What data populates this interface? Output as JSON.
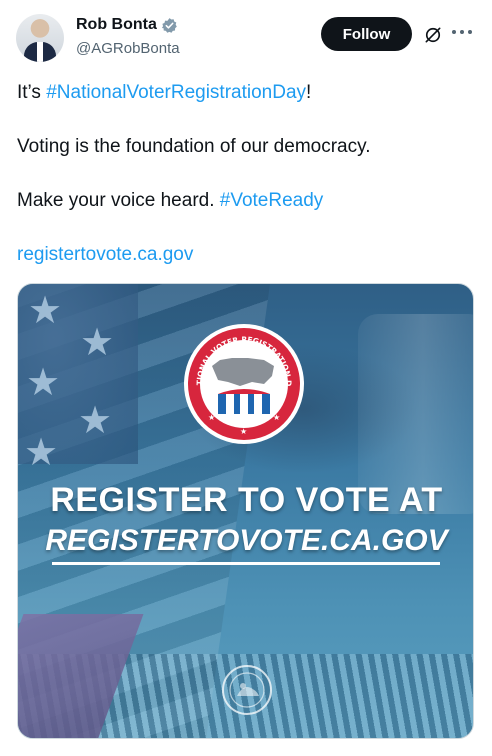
{
  "author": {
    "name": "Rob Bonta",
    "handle": "@AGRobBonta"
  },
  "actions": {
    "follow_label": "Follow"
  },
  "tweet": {
    "line1_prefix": "It’s ",
    "line1_hashtag": "#NationalVoterRegistrationDay",
    "line1_suffix": "!",
    "line2": "Voting is the foundation of our democracy.",
    "line3_prefix": "Make your voice heard. ",
    "line3_hashtag": "#VoteReady",
    "link": "registertovote.ca.gov"
  },
  "image": {
    "badge_text": "NATIONAL VOTER REGISTRATION DAY",
    "headline_line1": "REGISTER TO VOTE AT",
    "headline_line2": "REGISTERTOVOTE.CA.GOV"
  },
  "icons": [
    "verified-badge-icon",
    "grok-icon",
    "more-icon"
  ],
  "colors": {
    "link": "#1d9bf0",
    "follow_bg": "#0f1419",
    "verified": "#829aab",
    "badge_red": "#d7263d",
    "badge_blue": "#1f66b0"
  }
}
